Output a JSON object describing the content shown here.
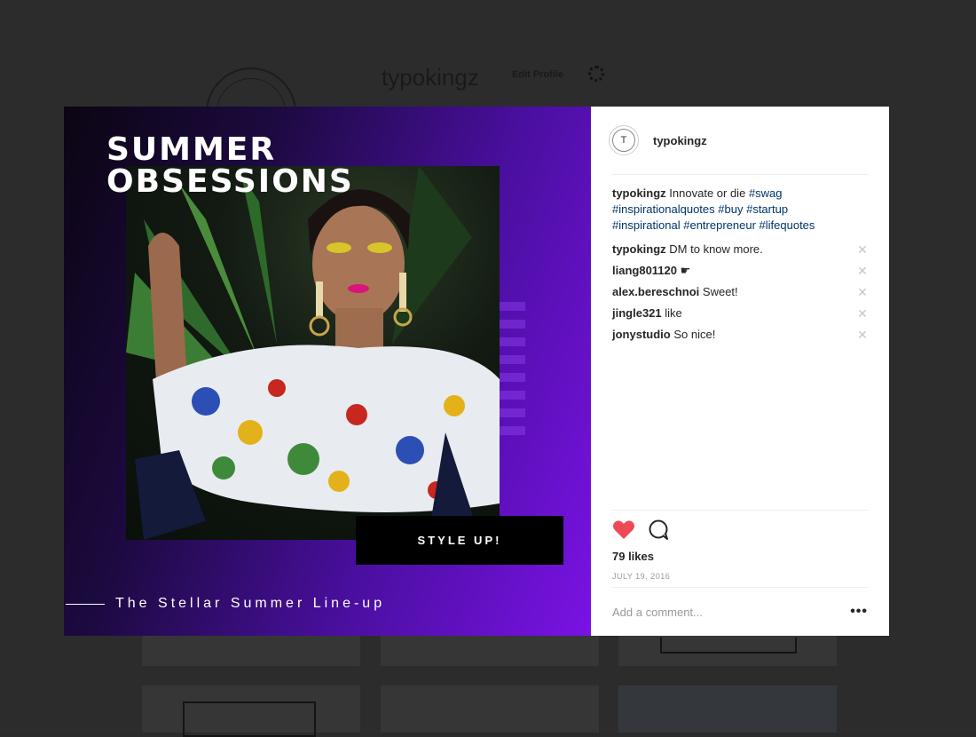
{
  "background_profile": {
    "username": "typokingz",
    "edit_profile_label": "Edit Profile"
  },
  "post_media": {
    "title_line1": "SUMMER",
    "title_line2": "OBSESSIONS",
    "cta_label": "STYLE UP!",
    "tagline": "The Stellar Summer Line-up"
  },
  "post_panel": {
    "username": "typokingz",
    "avatar_glyph": "T",
    "caption": {
      "user": "typokingz",
      "text": "Innovate or die",
      "hashtags_line1": [
        "#swag"
      ],
      "hashtags_line2": [
        "#inspirationalquotes",
        "#buy",
        "#startup"
      ],
      "hashtags_line3": [
        "#inspirational",
        "#entrepreneur",
        "#lifequotes"
      ]
    },
    "comments": [
      {
        "user": "typokingz",
        "text": "DM to know more."
      },
      {
        "user": "liang801120",
        "text": "☛"
      },
      {
        "user": "alex.bereschnoi",
        "text": "Sweet!"
      },
      {
        "user": "jingle321",
        "text": "like"
      },
      {
        "user": "jonystudio",
        "text": "So nice!"
      }
    ],
    "likes_label": "79 likes",
    "date_label": "JULY 19, 2016",
    "add_comment_placeholder": "Add a comment...",
    "more_label": "•••"
  },
  "colors": {
    "heart": "#ed4956",
    "hashtag": "#003569",
    "gradient_end": "#7a12e4"
  }
}
